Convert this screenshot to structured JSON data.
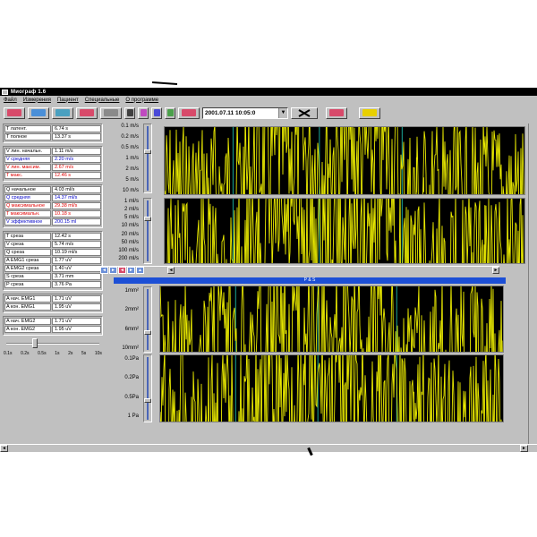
{
  "window": {
    "title": "Миограф 1.6"
  },
  "menu": [
    "Файл",
    "Измерения",
    "Пациент",
    "Специальные",
    "О программе"
  ],
  "toolbar": {
    "date_value": "2001.07.11 10:05:0",
    "dropdown_glyph": "▼",
    "buttons": [
      {
        "name": "open-button",
        "color": "#d84a6a"
      },
      {
        "name": "patient-button",
        "color": "#4a8fd8"
      },
      {
        "name": "record-button",
        "color": "#4aa0c0"
      },
      {
        "name": "measure-button",
        "color": "#d84a6a"
      },
      {
        "name": "print-button",
        "color": "#8a8a8a"
      }
    ]
  },
  "params": {
    "time": [
      {
        "label": "T латент.",
        "value": "6.74 s",
        "color": "black"
      },
      {
        "label": "T полное",
        "value": "13.37 s",
        "color": "black"
      }
    ],
    "velocity": [
      {
        "label": "V лин. начальн.",
        "value": "1.11 m/s",
        "color": "black"
      },
      {
        "label": "V средняя",
        "value": "2.20 m/s",
        "color": "blue"
      },
      {
        "label": "V лин. максим.",
        "value": "2.67 m/s",
        "color": "red"
      },
      {
        "label": "T макс.",
        "value": "12.46 s",
        "color": "red"
      }
    ],
    "flow": [
      {
        "label": "Q начальное",
        "value": "4.03 ml/s",
        "color": "black"
      },
      {
        "label": "Q средняя",
        "value": "14.37 ml/s",
        "color": "blue"
      },
      {
        "label": "Q максимальное",
        "value": "29.38 ml/s",
        "color": "red"
      },
      {
        "label": "T максимальн.",
        "value": "10.18 s",
        "color": "red"
      },
      {
        "label": "V эффективное",
        "value": "200.15 ml",
        "color": "blue"
      }
    ],
    "section": [
      {
        "label": "T среза",
        "value": "12.42 s",
        "color": "black"
      },
      {
        "label": "V среза",
        "value": "5.74 m/s",
        "color": "black"
      },
      {
        "label": "Q среза",
        "value": "10.19 ml/s",
        "color": "black"
      },
      {
        "label": "A EMG1 среза",
        "value": "1.77 uV",
        "color": "black"
      },
      {
        "label": "A EMG2 среза",
        "value": "1.40 uV",
        "color": "black"
      },
      {
        "label": "S среза",
        "value": "3.71 mm",
        "color": "black"
      },
      {
        "label": "P среза",
        "value": "3.76 Pa",
        "color": "black"
      }
    ],
    "emg1": [
      {
        "label": "A нач. EMG1",
        "value": "1.71 uV",
        "color": "black"
      },
      {
        "label": "A кон. EMG1",
        "value": "1.95 uV",
        "color": "black"
      }
    ],
    "emg2": [
      {
        "label": "A нач. EMG2",
        "value": "1.71 uV",
        "color": "black"
      },
      {
        "label": "A кон. EMG2",
        "value": "1.95 uV",
        "color": "black"
      }
    ]
  },
  "speed": {
    "labels": [
      "0.1s",
      "0.2s",
      "0.5s",
      "1s",
      "2s",
      "5s",
      "10s"
    ]
  },
  "plots": {
    "velocity_ticks": [
      "0.1 m/s",
      "0.2 m/s",
      "0.5 m/s",
      "1 m/s",
      "2 m/s",
      "5 m/s",
      "10 m/s"
    ],
    "flow_ticks": [
      "1 ml/s",
      "2 ml/s",
      "5 ml/s",
      "10 ml/s",
      "20 ml/s",
      "50 ml/s",
      "100 ml/s",
      "200 ml/s"
    ],
    "area_ticks": [
      "1mm²",
      "2mm²",
      "6mm²",
      "10mm²"
    ],
    "pressure_ticks": [
      "0.1Pa",
      "0.2Pa",
      "0.5Pa",
      "1 Pa"
    ],
    "subwindow_title": "Р & S",
    "trace_color": "#e8e800",
    "marker_color": "#1aa89a"
  },
  "scroll": {
    "left_glyph": "◄",
    "right_glyph": "►",
    "chan_buttons": [
      "◄",
      "►",
      "◄",
      "►",
      "▲"
    ]
  }
}
